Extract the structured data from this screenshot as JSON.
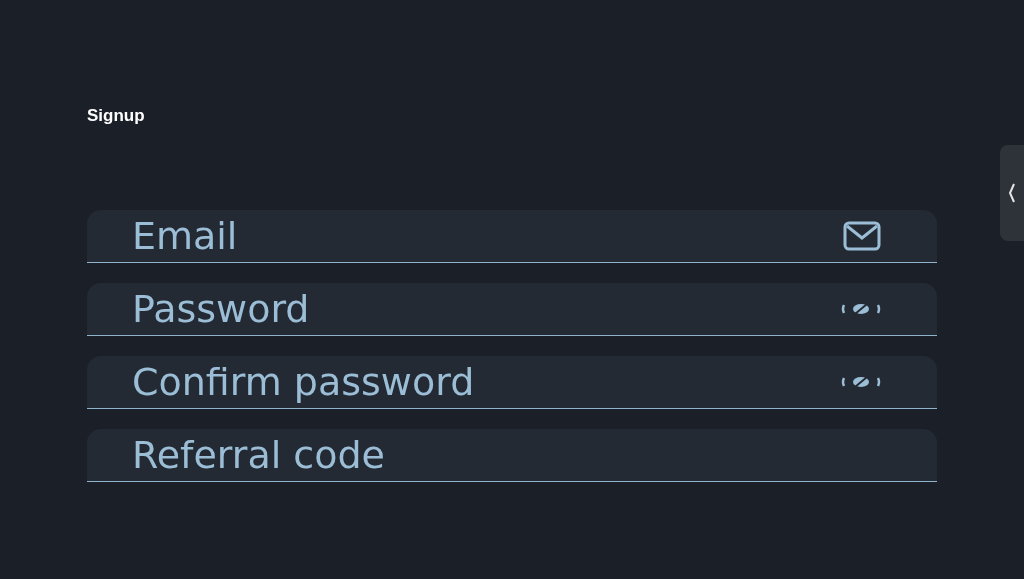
{
  "title": "Signup",
  "fields": [
    {
      "placeholder": "Email",
      "kind": "email"
    },
    {
      "placeholder": "Password",
      "kind": "password"
    },
    {
      "placeholder": "Confirm password",
      "kind": "password"
    },
    {
      "placeholder": "Referral code",
      "kind": "text"
    }
  ]
}
